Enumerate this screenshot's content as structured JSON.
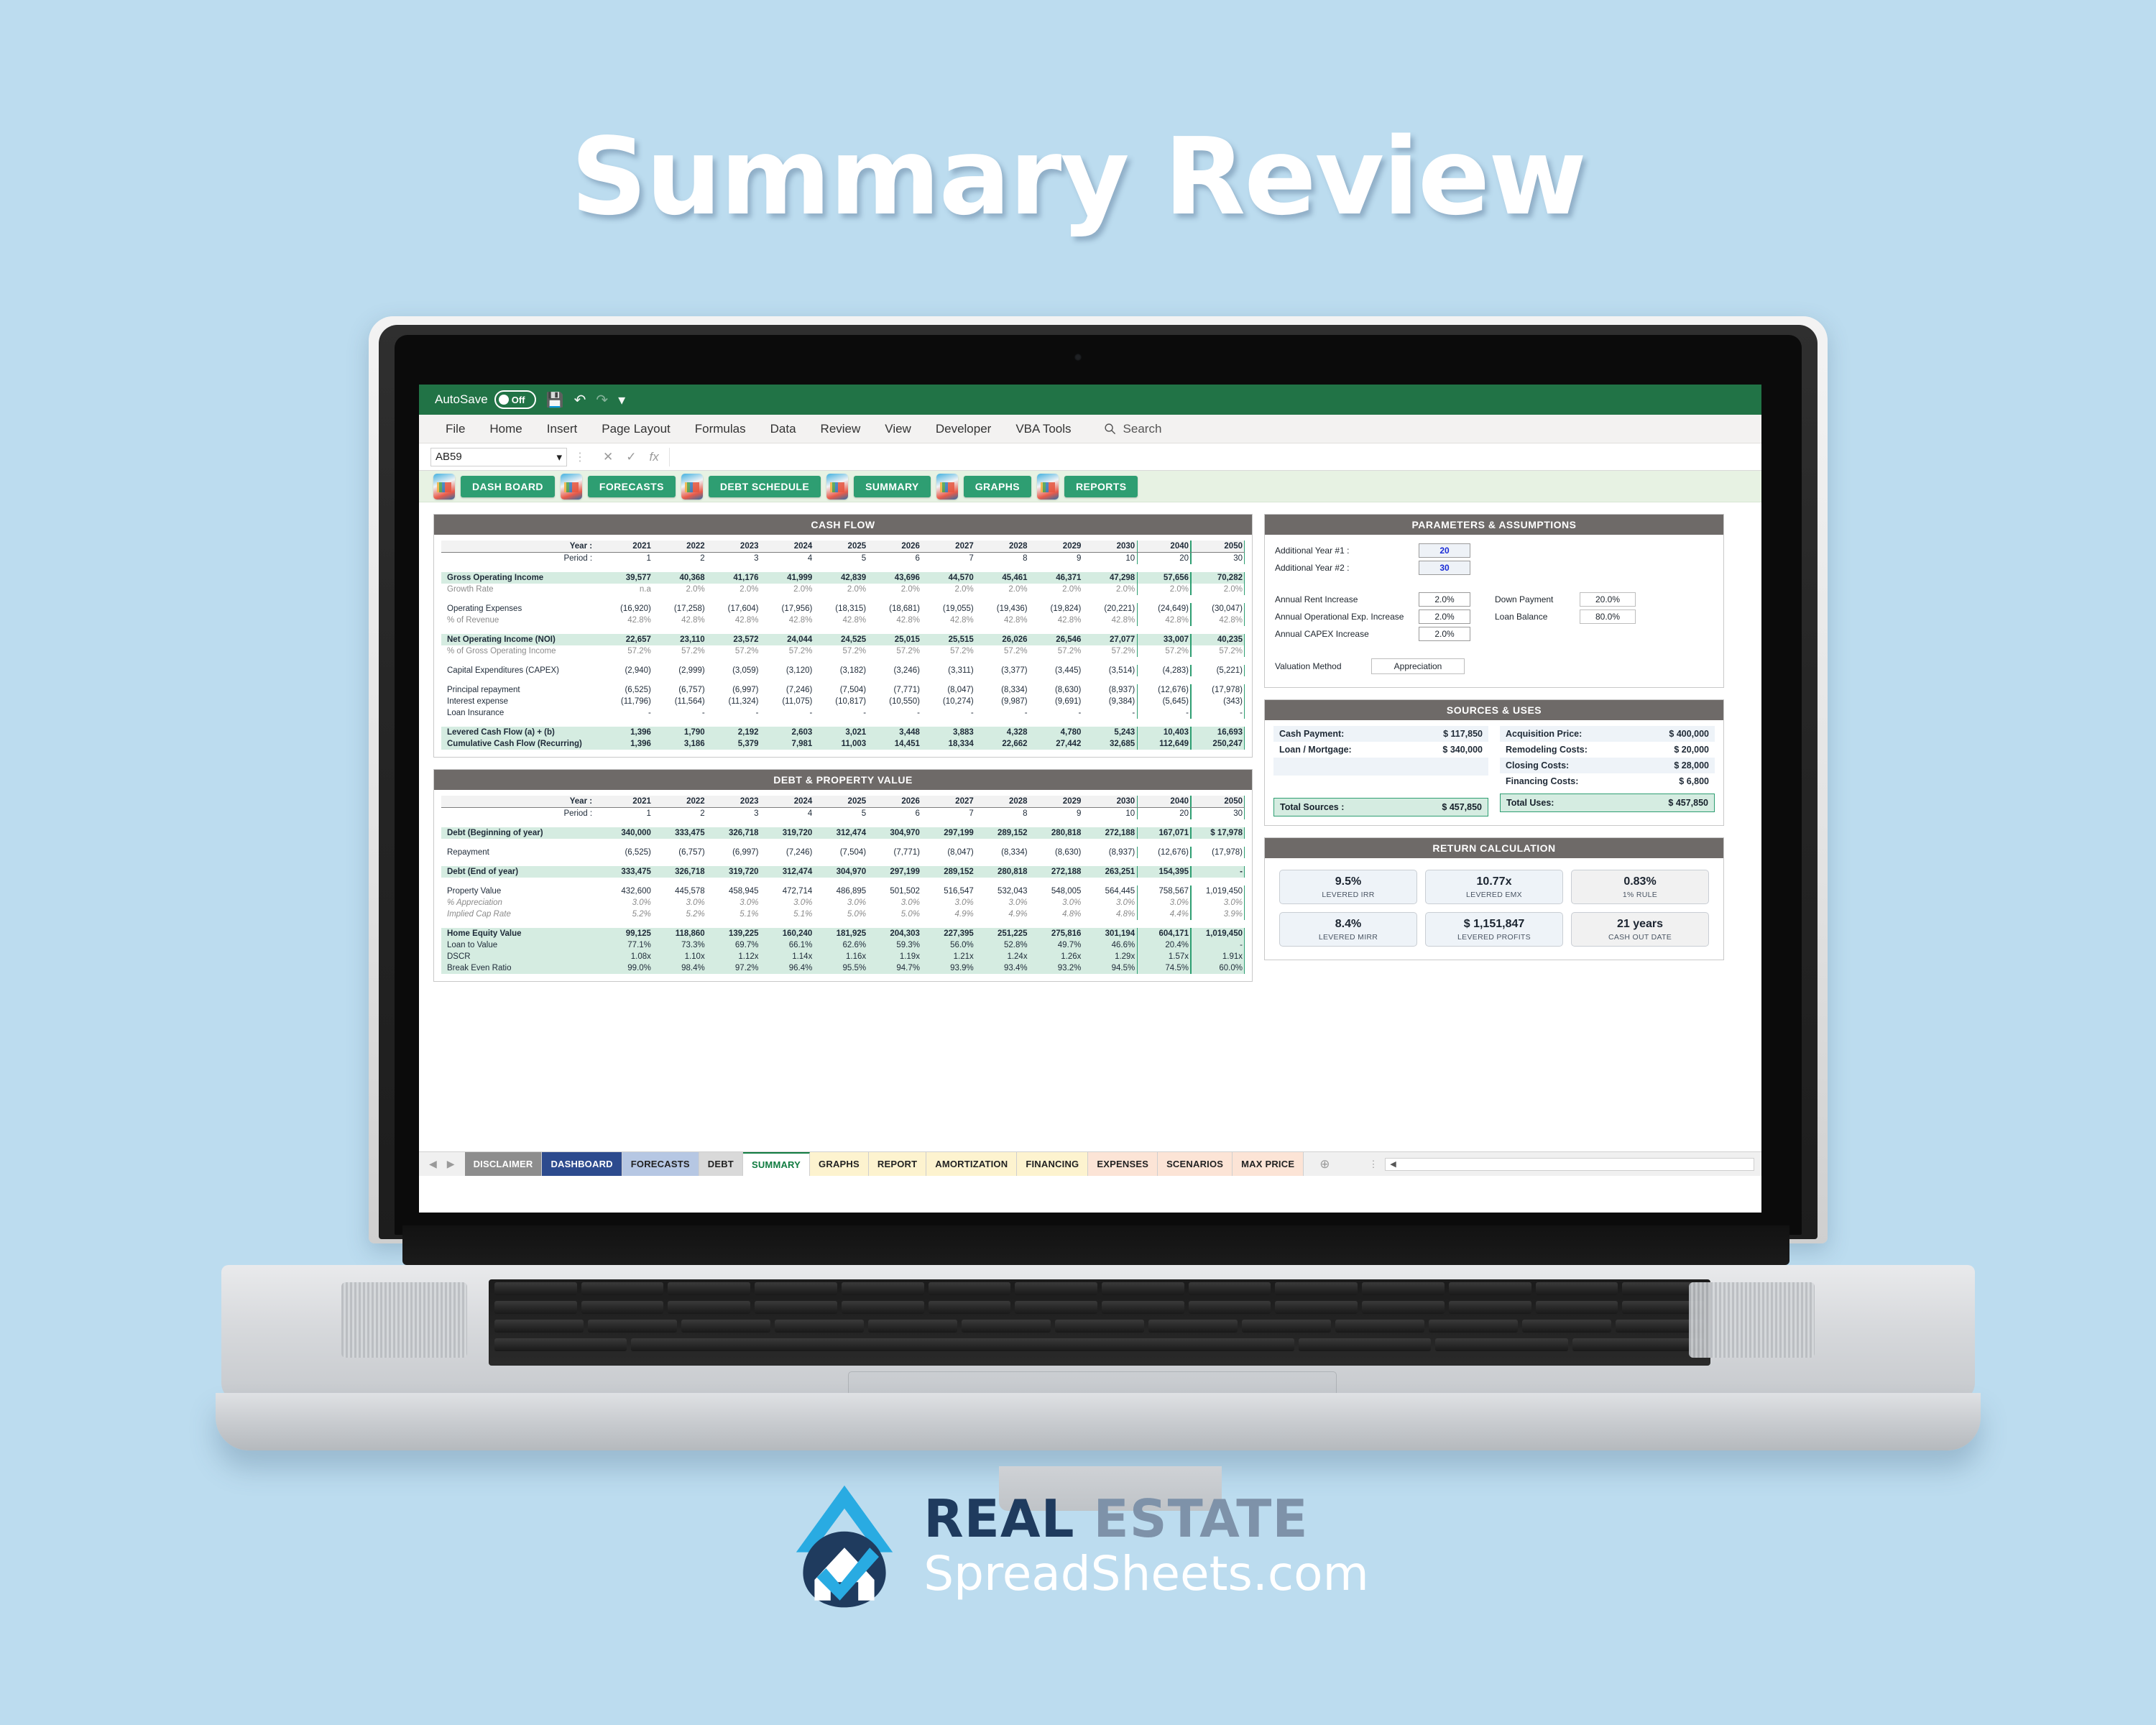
{
  "headline": "Summary Review",
  "excel": {
    "titlebar": {
      "autosave_label": "AutoSave",
      "autosave_state": "Off",
      "save_icon": "save-icon",
      "undo_icon": "undo-icon",
      "redo_icon": "redo-icon",
      "customize_icon": "customize-quick-access-icon"
    },
    "ribbon_tabs": [
      "File",
      "Home",
      "Insert",
      "Page Layout",
      "Formulas",
      "Data",
      "Review",
      "View",
      "Developer",
      "VBA Tools"
    ],
    "search_placeholder": "Search",
    "formula_bar": {
      "name_box": "AB59",
      "cancel_icon": "cancel-icon",
      "enter_icon": "confirm-icon",
      "function_icon": "insert-function-icon",
      "formula_value": ""
    },
    "nav_buttons": [
      "DASH BOARD",
      "FORECASTS",
      "DEBT SCHEDULE",
      "SUMMARY",
      "GRAPHS",
      "REPORTS"
    ],
    "sheet_tabs": [
      {
        "label": "DISCLAIMER",
        "color": "#8d8d8d",
        "active": false
      },
      {
        "label": "DASHBOARD",
        "color": "#2d4b8e",
        "active": false
      },
      {
        "label": "FORECASTS",
        "color": "#b6c7e3",
        "active": false
      },
      {
        "label": "DEBT",
        "color": "#d9d9d9",
        "active": false
      },
      {
        "label": "SUMMARY",
        "color": "#ffffff",
        "active": true
      },
      {
        "label": "GRAPHS",
        "color": "#fdf3cf",
        "active": false
      },
      {
        "label": "REPORT",
        "color": "#fdf3cf",
        "active": false
      },
      {
        "label": "AMORTIZATION",
        "color": "#fdf3cf",
        "active": false
      },
      {
        "label": "FINANCING",
        "color": "#fdf3cf",
        "active": false
      },
      {
        "label": "EXPENSES",
        "color": "#fce4d6",
        "active": false
      },
      {
        "label": "SCENARIOS",
        "color": "#fce4d6",
        "active": false
      },
      {
        "label": "MAX PRICE",
        "color": "#fce4d6",
        "active": false
      }
    ],
    "add_sheet_icon": "add-sheet-icon"
  },
  "cash_flow": {
    "title": "CASH FLOW",
    "year_label": "Year :",
    "period_label": "Period :",
    "years": [
      "2021",
      "2022",
      "2023",
      "2024",
      "2025",
      "2026",
      "2027",
      "2028",
      "2029",
      "2030",
      "2040",
      "2050"
    ],
    "periods": [
      "1",
      "2",
      "3",
      "4",
      "5",
      "6",
      "7",
      "8",
      "9",
      "10",
      "20",
      "30"
    ],
    "rows": [
      {
        "label": "Gross Operating Income",
        "style": "hl",
        "values": [
          "39,577",
          "40,368",
          "41,176",
          "41,999",
          "42,839",
          "43,696",
          "44,570",
          "45,461",
          "46,371",
          "47,298",
          "57,656",
          "70,282"
        ]
      },
      {
        "label": "Growth Rate",
        "style": "sub",
        "values": [
          "n.a",
          "2.0%",
          "2.0%",
          "2.0%",
          "2.0%",
          "2.0%",
          "2.0%",
          "2.0%",
          "2.0%",
          "2.0%",
          "2.0%",
          "2.0%"
        ]
      },
      {
        "label": "Operating Expenses",
        "style": "normal",
        "values": [
          "(16,920)",
          "(17,258)",
          "(17,604)",
          "(17,956)",
          "(18,315)",
          "(18,681)",
          "(19,055)",
          "(19,436)",
          "(19,824)",
          "(20,221)",
          "(24,649)",
          "(30,047)"
        ]
      },
      {
        "label": "% of Revenue",
        "style": "sub",
        "values": [
          "42.8%",
          "42.8%",
          "42.8%",
          "42.8%",
          "42.8%",
          "42.8%",
          "42.8%",
          "42.8%",
          "42.8%",
          "42.8%",
          "42.8%",
          "42.8%"
        ]
      },
      {
        "label": "Net Operating Income (NOI)",
        "style": "hl",
        "values": [
          "22,657",
          "23,110",
          "23,572",
          "24,044",
          "24,525",
          "25,015",
          "25,515",
          "26,026",
          "26,546",
          "27,077",
          "33,007",
          "40,235"
        ]
      },
      {
        "label": "% of Gross Operating Income",
        "style": "sub",
        "values": [
          "57.2%",
          "57.2%",
          "57.2%",
          "57.2%",
          "57.2%",
          "57.2%",
          "57.2%",
          "57.2%",
          "57.2%",
          "57.2%",
          "57.2%",
          "57.2%"
        ]
      },
      {
        "label": "Capital Expenditures (CAPEX)",
        "style": "normal",
        "values": [
          "(2,940)",
          "(2,999)",
          "(3,059)",
          "(3,120)",
          "(3,182)",
          "(3,246)",
          "(3,311)",
          "(3,377)",
          "(3,445)",
          "(3,514)",
          "(4,283)",
          "(5,221)"
        ]
      },
      {
        "label": "Principal repayment",
        "style": "normal",
        "values": [
          "(6,525)",
          "(6,757)",
          "(6,997)",
          "(7,246)",
          "(7,504)",
          "(7,771)",
          "(8,047)",
          "(8,334)",
          "(8,630)",
          "(8,937)",
          "(12,676)",
          "(17,978)"
        ]
      },
      {
        "label": "Interest expense",
        "style": "normal",
        "values": [
          "(11,796)",
          "(11,564)",
          "(11,324)",
          "(11,075)",
          "(10,817)",
          "(10,550)",
          "(10,274)",
          "(9,987)",
          "(9,691)",
          "(9,384)",
          "(5,645)",
          "(343)"
        ]
      },
      {
        "label": "Loan Insurance",
        "style": "normal",
        "values": [
          "-",
          "-",
          "-",
          "-",
          "-",
          "-",
          "-",
          "-",
          "-",
          "-",
          "-",
          "-"
        ]
      },
      {
        "label": "Levered Cash Flow (a) + (b)",
        "style": "hl",
        "values": [
          "1,396",
          "1,790",
          "2,192",
          "2,603",
          "3,021",
          "3,448",
          "3,883",
          "4,328",
          "4,780",
          "5,243",
          "10,403",
          "16,693"
        ]
      },
      {
        "label": "Cumulative Cash Flow (Recurring)",
        "style": "hl",
        "values": [
          "1,396",
          "3,186",
          "5,379",
          "7,981",
          "11,003",
          "14,451",
          "18,334",
          "22,662",
          "27,442",
          "32,685",
          "112,649",
          "250,247"
        ]
      }
    ]
  },
  "debt_property": {
    "title": "DEBT & PROPERTY VALUE",
    "year_label": "Year :",
    "period_label": "Period :",
    "years": [
      "2021",
      "2022",
      "2023",
      "2024",
      "2025",
      "2026",
      "2027",
      "2028",
      "2029",
      "2030",
      "2040",
      "2050"
    ],
    "periods": [
      "1",
      "2",
      "3",
      "4",
      "5",
      "6",
      "7",
      "8",
      "9",
      "10",
      "20",
      "30"
    ],
    "rows": [
      {
        "label": "Debt (Beginning of year)",
        "style": "hl",
        "values": [
          "340,000",
          "333,475",
          "326,718",
          "319,720",
          "312,474",
          "304,970",
          "297,199",
          "289,152",
          "280,818",
          "272,188",
          "167,071",
          "$ 17,978"
        ]
      },
      {
        "label": "Repayment",
        "style": "normal",
        "values": [
          "(6,525)",
          "(6,757)",
          "(6,997)",
          "(7,246)",
          "(7,504)",
          "(7,771)",
          "(8,047)",
          "(8,334)",
          "(8,630)",
          "(8,937)",
          "(12,676)",
          "(17,978)"
        ]
      },
      {
        "label": "Debt (End of year)",
        "style": "hl",
        "values": [
          "333,475",
          "326,718",
          "319,720",
          "312,474",
          "304,970",
          "297,199",
          "289,152",
          "280,818",
          "272,188",
          "263,251",
          "154,395",
          "-"
        ]
      },
      {
        "label": "Property Value",
        "style": "normal",
        "values": [
          "432,600",
          "445,578",
          "458,945",
          "472,714",
          "486,895",
          "501,502",
          "516,547",
          "532,043",
          "548,005",
          "564,445",
          "758,567",
          "1,019,450"
        ]
      },
      {
        "label": "% Appreciation",
        "style": "sub ital",
        "values": [
          "3.0%",
          "3.0%",
          "3.0%",
          "3.0%",
          "3.0%",
          "3.0%",
          "3.0%",
          "3.0%",
          "3.0%",
          "3.0%",
          "3.0%",
          "3.0%"
        ]
      },
      {
        "label": "Implied Cap Rate",
        "style": "sub ital",
        "values": [
          "5.2%",
          "5.2%",
          "5.1%",
          "5.1%",
          "5.0%",
          "5.0%",
          "4.9%",
          "4.9%",
          "4.8%",
          "4.8%",
          "4.4%",
          "3.9%"
        ]
      },
      {
        "label": "Home Equity Value",
        "style": "hl",
        "values": [
          "99,125",
          "118,860",
          "139,225",
          "160,240",
          "181,925",
          "204,303",
          "227,395",
          "251,225",
          "275,816",
          "301,194",
          "604,171",
          "1,019,450"
        ]
      },
      {
        "label": "Loan to Value",
        "style": "hlplain",
        "values": [
          "77.1%",
          "73.3%",
          "69.7%",
          "66.1%",
          "62.6%",
          "59.3%",
          "56.0%",
          "52.8%",
          "49.7%",
          "46.6%",
          "20.4%",
          "-"
        ]
      },
      {
        "label": "DSCR",
        "style": "hlplain",
        "values": [
          "1.08x",
          "1.10x",
          "1.12x",
          "1.14x",
          "1.16x",
          "1.19x",
          "1.21x",
          "1.24x",
          "1.26x",
          "1.29x",
          "1.57x",
          "1.91x"
        ]
      },
      {
        "label": "Break Even Ratio",
        "style": "hlplain",
        "values": [
          "99.0%",
          "98.4%",
          "97.2%",
          "96.4%",
          "95.5%",
          "94.7%",
          "93.9%",
          "93.4%",
          "93.2%",
          "94.5%",
          "74.5%",
          "60.0%"
        ]
      }
    ]
  },
  "parameters": {
    "title": "PARAMETERS & ASSUMPTIONS",
    "rows": [
      {
        "label": "Additional Year #1 :",
        "value": "20"
      },
      {
        "label": "Additional Year #2 :",
        "value": "30"
      }
    ],
    "increases": [
      {
        "label": "Annual Rent Increase",
        "value": "2.0%"
      },
      {
        "label": "Annual Operational Exp. Increase",
        "value": "2.0%"
      },
      {
        "label": "Annual CAPEX Increase",
        "value": "2.0%"
      }
    ],
    "financing": [
      {
        "label": "Down Payment",
        "value": "20.0%"
      },
      {
        "label": "Loan Balance",
        "value": "80.0%"
      }
    ],
    "valuation_label": "Valuation Method",
    "valuation_value": "Appreciation"
  },
  "sources_uses": {
    "title": "SOURCES & USES",
    "sources": [
      {
        "label": "Cash Payment:",
        "value": "$ 117,850"
      },
      {
        "label": "Loan / Mortgage:",
        "value": "$ 340,000"
      }
    ],
    "uses": [
      {
        "label": "Acquisition Price:",
        "value": "$ 400,000"
      },
      {
        "label": "Remodeling Costs:",
        "value": "$ 20,000"
      },
      {
        "label": "Closing Costs:",
        "value": "$ 28,000"
      },
      {
        "label": "Financing Costs:",
        "value": "$ 6,800"
      }
    ],
    "total_sources_label": "Total Sources :",
    "total_sources_value": "$ 457,850",
    "total_uses_label": "Total Uses:",
    "total_uses_value": "$ 457,850"
  },
  "return_calculation": {
    "title": "RETURN CALCULATION",
    "cards": [
      {
        "value": "9.5%",
        "label": "LEVERED IRR",
        "tone": "blue"
      },
      {
        "value": "10.77x",
        "label": "LEVERED EMX",
        "tone": "blue"
      },
      {
        "value": "0.83%",
        "label": "1% RULE",
        "tone": "grey"
      },
      {
        "value": "8.4%",
        "label": "LEVERED MIRR",
        "tone": "blue"
      },
      {
        "value": "$ 1,151,847",
        "label": "LEVERED PROFITS",
        "tone": "blue"
      },
      {
        "value": "21 years",
        "label": "CASH OUT DATE",
        "tone": "grey"
      }
    ]
  },
  "footer_logo": {
    "line1_a": "REAL",
    "line1_b": "ESTATE",
    "line2": "SpreadSheets.com",
    "mark": "house-check-logo-icon"
  },
  "colors": {
    "background": "#bcdcef",
    "excel_green": "#217346",
    "panel_header": "#6e6a68",
    "highlight_green": "#d5ece1",
    "accent_green": "#2e9e72",
    "nav_strip": "#e7f2e3"
  }
}
